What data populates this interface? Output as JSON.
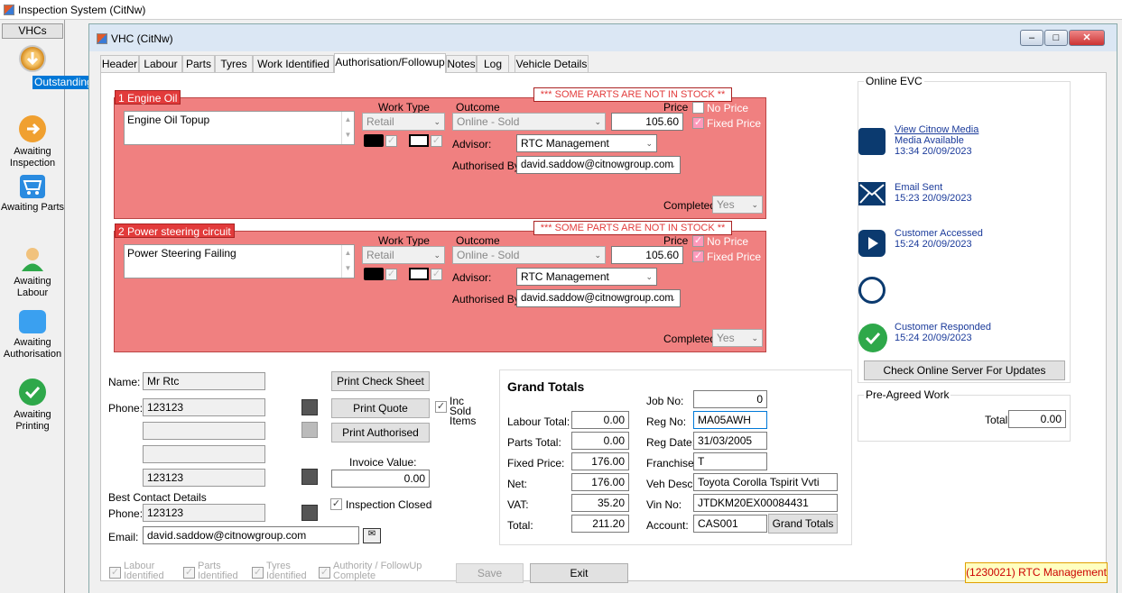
{
  "window": {
    "title": "Inspection System (CitNw)"
  },
  "sidebar": {
    "header": "VHCs",
    "items": [
      {
        "label": "Outstanding",
        "icon": "download-arrow-icon",
        "color": "#e6a23c"
      },
      {
        "label": "Awaiting Inspection",
        "icon": "right-arrow-icon",
        "color": "#f0a030"
      },
      {
        "label": "Awaiting Parts",
        "icon": "cart-icon",
        "color": "#2a8be0"
      },
      {
        "label": "Awaiting Labour",
        "icon": "user-icon",
        "color": "#2ea84a"
      },
      {
        "label": "Awaiting Authorisation",
        "icon": "speech-bubble-icon",
        "color": "#3aa0f0"
      },
      {
        "label": "Awaiting Printing",
        "icon": "check-icon",
        "color": "#2ea84a"
      }
    ]
  },
  "child_window": {
    "title": "VHC (CitNw)"
  },
  "tabs": [
    "Header",
    "Labour",
    "Parts",
    "Tyres",
    "Work Identified",
    "Authorisation/Followup",
    "Notes",
    "Log",
    "Vehicle Details"
  ],
  "items": [
    {
      "title": "1 Engine Oil",
      "stock_warning": "*** SOME PARTS ARE NOT IN STOCK **",
      "description": "Engine Oil Topup",
      "work_type_label": "Work Type",
      "work_type": "Retail",
      "outcome_label": "Outcome",
      "outcome": "Online - Sold",
      "price_label": "Price",
      "price": "105.60",
      "no_price_label": "No Price",
      "no_price": false,
      "fixed_price_label": "Fixed Price",
      "fixed_price": true,
      "advisor_label": "Advisor:",
      "advisor": "RTC Management",
      "authorised_by_label": "Authorised By",
      "authorised_by": "david.saddow@citnowgroup.com",
      "completed_label": "Completed:",
      "completed": "Yes"
    },
    {
      "title": "2 Power steering circuit",
      "stock_warning": "*** SOME PARTS ARE NOT IN STOCK **",
      "description": "Power Steering Failing",
      "work_type_label": "Work Type",
      "work_type": "Retail",
      "outcome_label": "Outcome",
      "outcome": "Online - Sold",
      "price_label": "Price",
      "price": "105.60",
      "no_price_label": "No Price",
      "no_price": true,
      "fixed_price_label": "Fixed Price",
      "fixed_price": true,
      "advisor_label": "Advisor:",
      "advisor": "RTC Management",
      "authorised_by_label": "Authorised By",
      "authorised_by": "david.saddow@citnowgroup.com",
      "completed_label": "Completed:",
      "completed": "Yes"
    }
  ],
  "customer": {
    "name_label": "Name:",
    "name": "Mr Rtc",
    "phone_label": "Phone:",
    "phone": "123123",
    "phone2": "",
    "phone3": "",
    "phone4": "123123",
    "best_contact_label": "Best Contact Details",
    "best_phone_label": "Phone:",
    "best_phone": "123123",
    "email_label": "Email:",
    "email": "david.saddow@citnowgroup.com"
  },
  "actions": {
    "print_check_sheet": "Print Check Sheet",
    "print_quote": "Print Quote",
    "print_authorised": "Print Authorised",
    "inc_sold_items": "Inc Sold Items",
    "invoice_value_label": "Invoice Value:",
    "invoice_value": "0.00",
    "inspection_closed": "Inspection Closed"
  },
  "grand_totals": {
    "title": "Grand Totals",
    "labour_total_label": "Labour Total:",
    "labour_total": "0.00",
    "parts_total_label": "Parts Total:",
    "parts_total": "0.00",
    "fixed_price_label": "Fixed Price:",
    "fixed_price": "176.00",
    "net_label": "Net:",
    "net": "176.00",
    "vat_label": "VAT:",
    "vat": "35.20",
    "total_label": "Total:",
    "total": "211.20",
    "job_no_label": "Job No:",
    "job_no": "0",
    "reg_no_label": "Reg No:",
    "reg_no": "MA05AWH",
    "reg_date_label": "Reg Date:",
    "reg_date": "31/03/2005",
    "franchise_label": "Franchise:",
    "franchise": "T",
    "veh_desc_label": "Veh Desc:",
    "veh_desc": "Toyota Corolla Tspirit Vvti",
    "vin_no_label": "Vin No:",
    "vin_no": "JTDKM20EX00084431",
    "account_label": "Account:",
    "account": "CAS001",
    "button": "Grand Totals"
  },
  "online_evc": {
    "title": "Online EVC",
    "events": [
      {
        "icon": "media-phone-icon",
        "lines": [
          "View Citnow Media",
          "Media Available",
          "13:34 20/09/2023"
        ]
      },
      {
        "icon": "envelope-icon",
        "lines": [
          "Email Sent",
          "15:23 20/09/2023"
        ]
      },
      {
        "icon": "play-icon",
        "lines": [
          "Customer Accessed",
          "15:24 20/09/2023"
        ]
      },
      {
        "icon": "chat-icon",
        "lines": []
      },
      {
        "icon": "check-circle-icon",
        "lines": [
          "Customer Responded",
          "15:24 20/09/2023"
        ]
      }
    ],
    "check_button": "Check Online Server For Updates"
  },
  "pre_agreed": {
    "title": "Pre-Agreed Work",
    "total_label": "Total:",
    "total": "0.00"
  },
  "footer": {
    "labour_identified": "Labour Identified",
    "parts_identified": "Parts Identified",
    "tyres_identified": "Tyres Identified",
    "authority_complete": "Authority / FollowUp Complete",
    "save": "Save",
    "exit": "Exit",
    "user": "(1230021) RTC Management"
  }
}
